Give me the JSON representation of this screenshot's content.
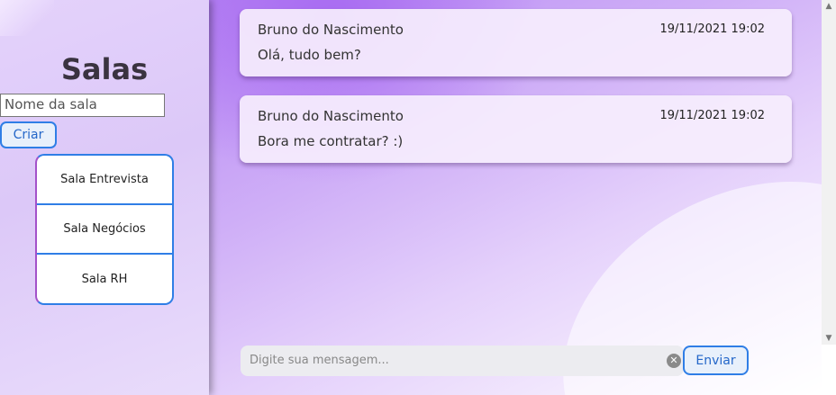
{
  "sidebar": {
    "title": "Salas",
    "room_input_placeholder": "Nome da sala",
    "create_label": "Criar",
    "rooms": [
      {
        "label": "Sala Entrevista"
      },
      {
        "label": "Sala Negócios"
      },
      {
        "label": "Sala RH"
      }
    ]
  },
  "messages": [
    {
      "author": "Bruno do Nascimento",
      "timestamp": "19/11/2021 19:02",
      "text": "Olá, tudo bem?"
    },
    {
      "author": "Bruno do Nascimento",
      "timestamp": "19/11/2021 19:02",
      "text": "Bora me contratar? :)"
    }
  ],
  "composer": {
    "placeholder": "Digite sua mensagem...",
    "clear_icon": "clear-icon",
    "send_label": "Enviar"
  },
  "colors": {
    "accent_blue": "#2f7ee6",
    "sidebar_bg": "#dcc8f8",
    "chat_purple": "#b889f4"
  }
}
